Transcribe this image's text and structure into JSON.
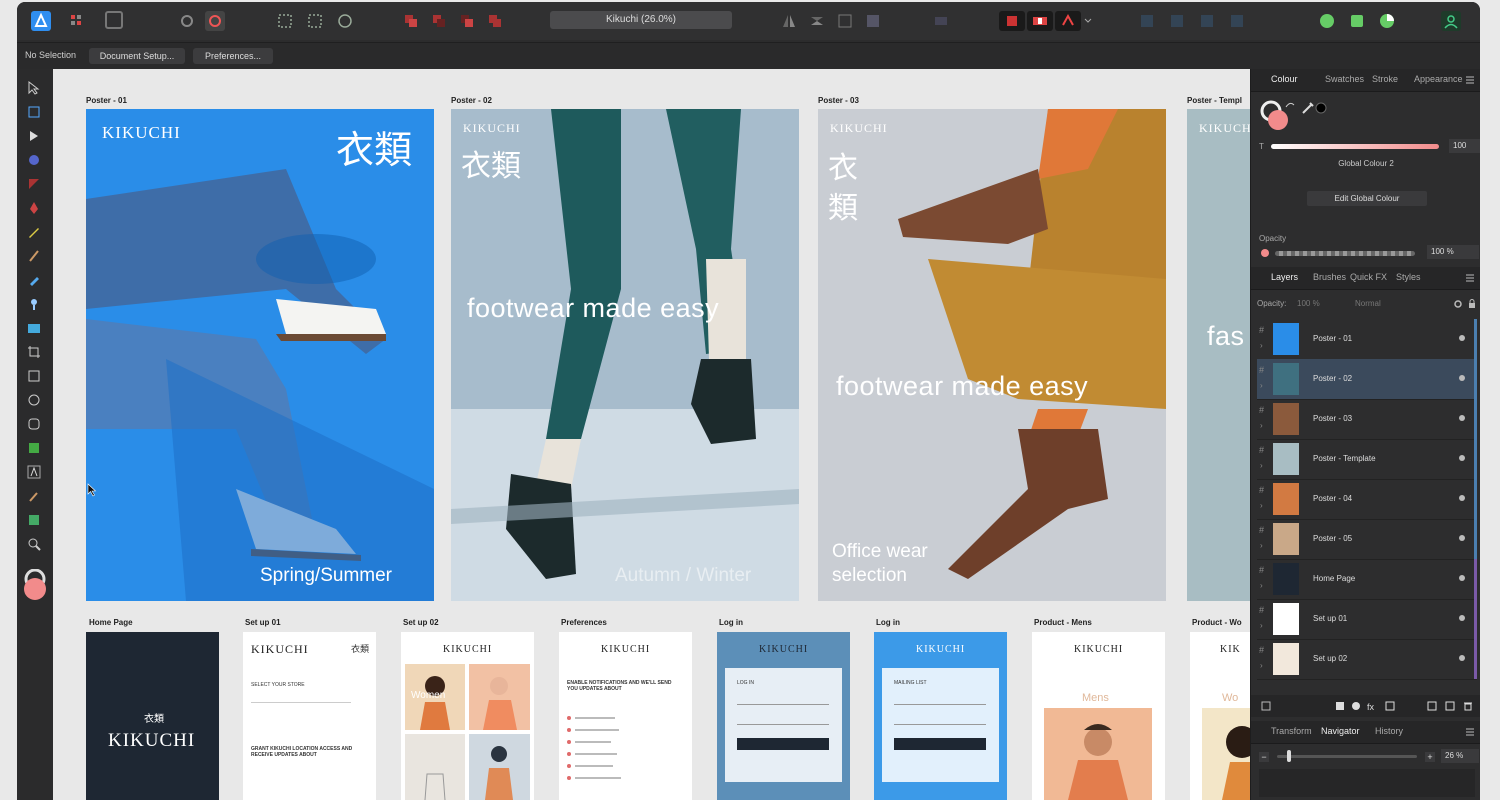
{
  "window": {
    "document_title": "Kikuchi (26.0%)"
  },
  "context_bar": {
    "selection": "No Selection",
    "document_setup": "Document Setup...",
    "preferences": "Preferences..."
  },
  "artboards": {
    "poster1": {
      "label": "Poster - 01",
      "brand": "KIKUCHI",
      "kanji": "衣類",
      "season": "Spring/Summer"
    },
    "poster2": {
      "label": "Poster - 02",
      "brand": "KIKUCHI",
      "kanji": "衣類",
      "tagline": "footwear made easy",
      "season": "Autumn / Winter"
    },
    "poster3": {
      "label": "Poster - 03",
      "brand": "KIKUCHI",
      "kanji1": "衣",
      "kanji2": "類",
      "tagline": "footwear made easy",
      "office1": "Office wear",
      "office2": "selection"
    },
    "poster4": {
      "label": "Poster - Templ",
      "brand": "KIKUCHI",
      "partial": "fas"
    },
    "home": {
      "label": "Home Page",
      "kanji": "衣類",
      "brand": "KIKUCHI"
    },
    "setup1": {
      "label": "Set up 01",
      "brand": "KIKUCHI",
      "kanji": "衣類",
      "heading": "SELECT YOUR STORE",
      "grant": "GRANT KIKUCHI LOCATION ACCESS AND RECEIVE UPDATES ABOUT"
    },
    "setup2": {
      "label": "Set up 02",
      "brand": "KIKUCHI",
      "women": "Women"
    },
    "prefs": {
      "label": "Preferences",
      "brand": "KIKUCHI",
      "heading": "ENABLE NOTIFICATIONS AND WE'LL SEND YOU UPDATES ABOUT"
    },
    "login1": {
      "label": "Log in",
      "brand": "KIKUCHI",
      "heading": "LOG IN"
    },
    "login2": {
      "label": "Log in",
      "brand": "KIKUCHI",
      "heading": "MAILING LIST"
    },
    "mens": {
      "label": "Product - Mens",
      "brand": "KIKUCHI",
      "heading": "Mens"
    },
    "womens": {
      "label": "Product - Wo",
      "brand": "KIK",
      "heading": "Wo"
    }
  },
  "colour_panel": {
    "tabs": [
      "Colour",
      "Swatches",
      "Stroke",
      "Appearance"
    ],
    "tint_label": "T",
    "tint_value": "100",
    "global_name": "Global Colour 2",
    "edit_button": "Edit Global Colour",
    "opacity_label": "Opacity",
    "opacity_value": "100 %",
    "fill_color": "#f28b8b"
  },
  "layers_panel": {
    "tabs": [
      "Layers",
      "Brushes",
      "Quick FX",
      "Styles"
    ],
    "opacity_label": "Opacity:",
    "opacity_value": "100 %",
    "blend_mode": "Normal",
    "layers": [
      "Poster - 01",
      "Poster - 02",
      "Poster - 03",
      "Poster - Template",
      "Poster - 04",
      "Poster - 05",
      "Home Page",
      "Set up 01",
      "Set up 02"
    ]
  },
  "navigator_panel": {
    "tabs": [
      "Transform",
      "Navigator",
      "History"
    ],
    "zoom": "26 %"
  },
  "colors": {
    "accent": "#2f8ef0",
    "poster1_bg": "#2d8fe8",
    "poster2_bg": "#9fb3c4",
    "poster3_bg": "#c8ccd2",
    "fill": "#f28b8b"
  }
}
